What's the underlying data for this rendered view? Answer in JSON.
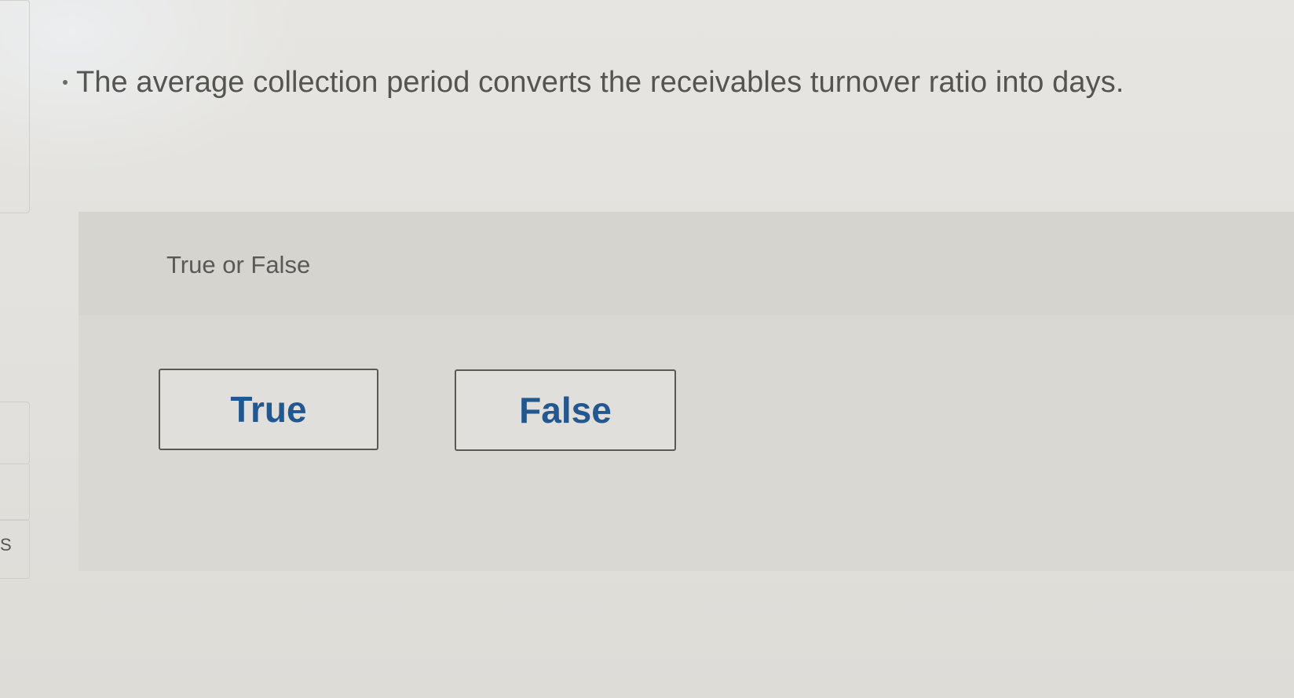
{
  "question": {
    "text": "The average collection period converts the receivables turnover ratio into days."
  },
  "answer_area": {
    "type_label": "True or False",
    "options": [
      {
        "label": "True"
      },
      {
        "label": "False"
      }
    ]
  },
  "left_edge": {
    "partial_letter": "S"
  }
}
